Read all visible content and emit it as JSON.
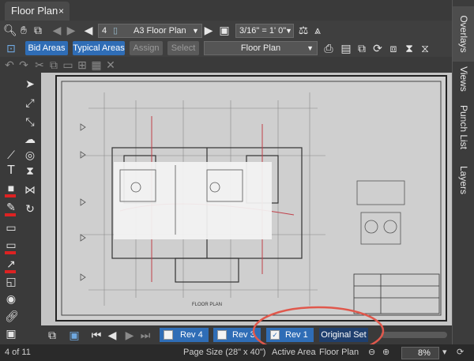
{
  "tab": {
    "title": "Floor Plan",
    "close": "×"
  },
  "right_panel": {
    "tabs": [
      "Overlays",
      "Views",
      "Punch List",
      "Layers"
    ]
  },
  "toolbar": {
    "page_number": "4",
    "page_name": "A3 Floor Plan",
    "scale": "3/16\" = 1' 0\"",
    "bid_areas": "Bid Areas",
    "typical_areas": "Typical Areas",
    "assign": "Assign",
    "select": "Select",
    "view_name": "Floor Plan"
  },
  "bottom_nav": {
    "revisions": [
      {
        "label": "Rev 4",
        "checked": false
      },
      {
        "label": "Rev 3",
        "checked": false
      },
      {
        "label": "Rev 1",
        "checked": true
      }
    ],
    "original_set": "Original Set"
  },
  "drawing": {
    "title": "FLOOR PLAN"
  },
  "status": {
    "page_count": "4 of 11",
    "page_size": "Page Size (28\" x 40\")",
    "active_area": "Active Area",
    "floor_plan": "Floor Plan",
    "zoom": "8%"
  },
  "colors": {
    "accent": "#2f6db6",
    "highlight_circle": "#e0584c",
    "background": "#2b2b2b"
  }
}
